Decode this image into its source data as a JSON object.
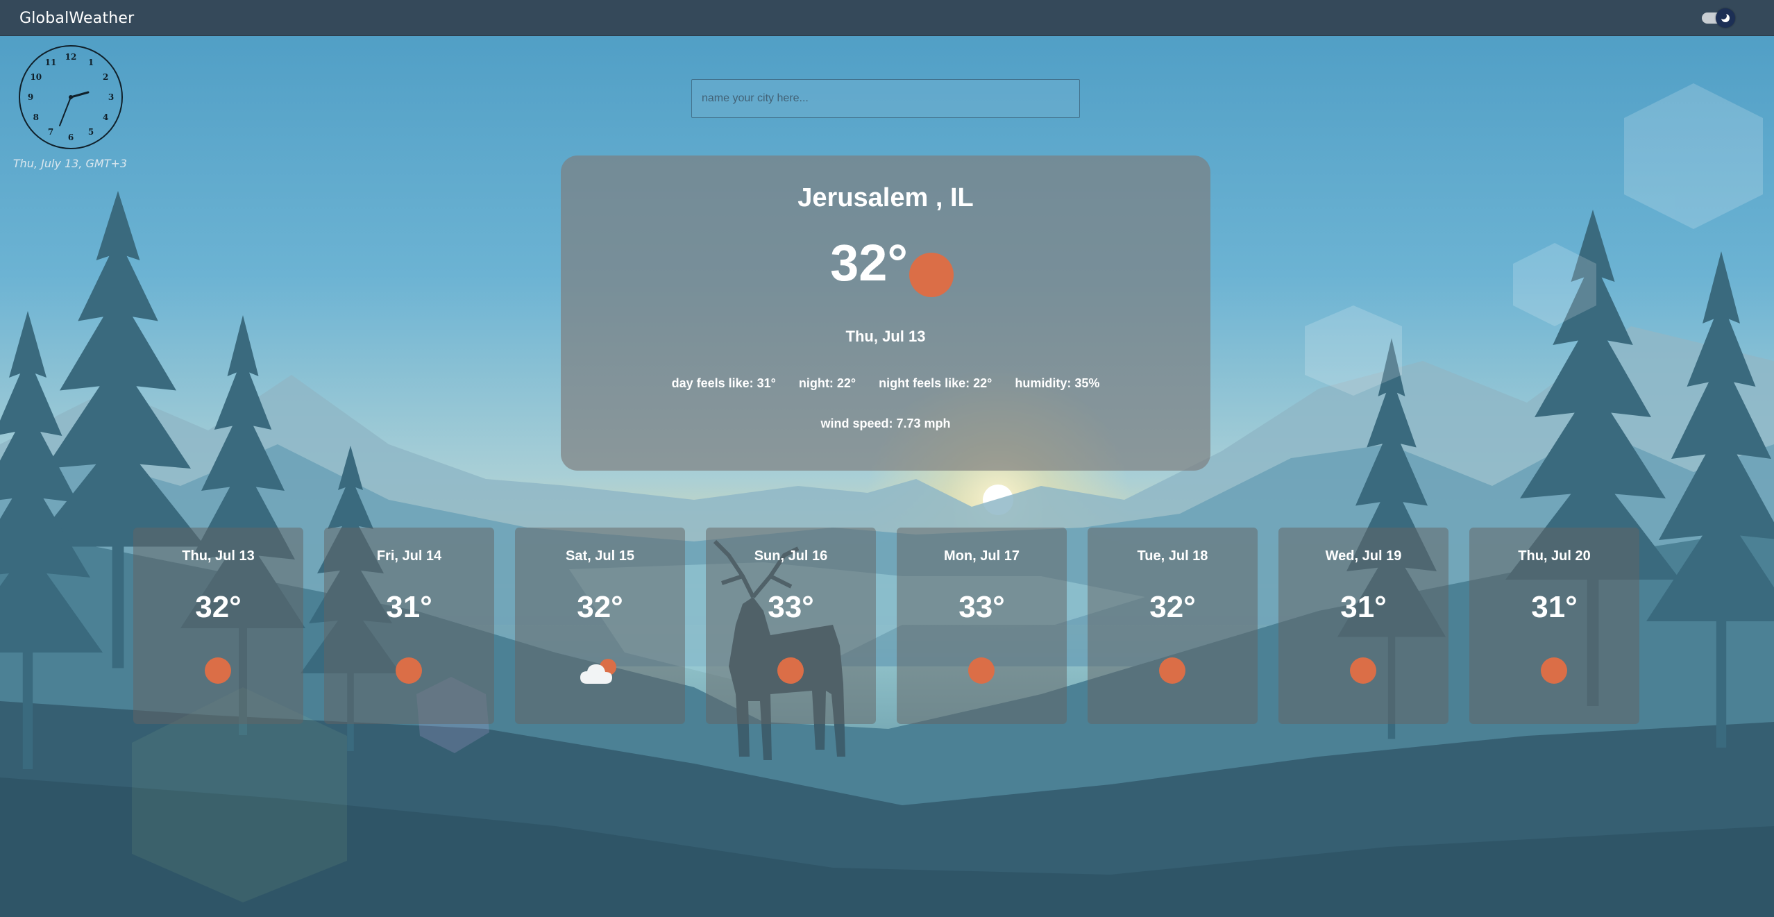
{
  "app": {
    "title": "GlobalWeather"
  },
  "clock": {
    "date_label": "Thu, July 13, GMT+3",
    "numerals": [
      "12",
      "1",
      "2",
      "3",
      "4",
      "5",
      "6",
      "7",
      "8",
      "9",
      "10",
      "11"
    ]
  },
  "search": {
    "placeholder": "name your city here..."
  },
  "current": {
    "city": "Jerusalem , IL",
    "temperature": "32°",
    "condition_icon": "sun-icon",
    "date": "Thu, Jul 13",
    "day_feels_like": "day feels like: 31°",
    "night": "night: 22°",
    "night_feels_like": "night feels like: 22°",
    "humidity": "humidity: 35%",
    "wind_speed": "wind speed: 7.73 mph"
  },
  "forecast": [
    {
      "date": "Thu, Jul 13",
      "temp": "32°",
      "icon": "sun-icon"
    },
    {
      "date": "Fri, Jul 14",
      "temp": "31°",
      "icon": "sun-icon"
    },
    {
      "date": "Sat, Jul 15",
      "temp": "32°",
      "icon": "partly-cloudy-icon"
    },
    {
      "date": "Sun, Jul 16",
      "temp": "33°",
      "icon": "sun-icon"
    },
    {
      "date": "Mon, Jul 17",
      "temp": "33°",
      "icon": "sun-icon"
    },
    {
      "date": "Tue, Jul 18",
      "temp": "32°",
      "icon": "sun-icon"
    },
    {
      "date": "Wed, Jul 19",
      "temp": "31°",
      "icon": "sun-icon"
    },
    {
      "date": "Thu, Jul 20",
      "temp": "31°",
      "icon": "sun-icon"
    }
  ],
  "colors": {
    "navbar": "#35495a",
    "sun_icon": "#db6e47",
    "card_background": "rgba(125,125,125,0.68)"
  }
}
